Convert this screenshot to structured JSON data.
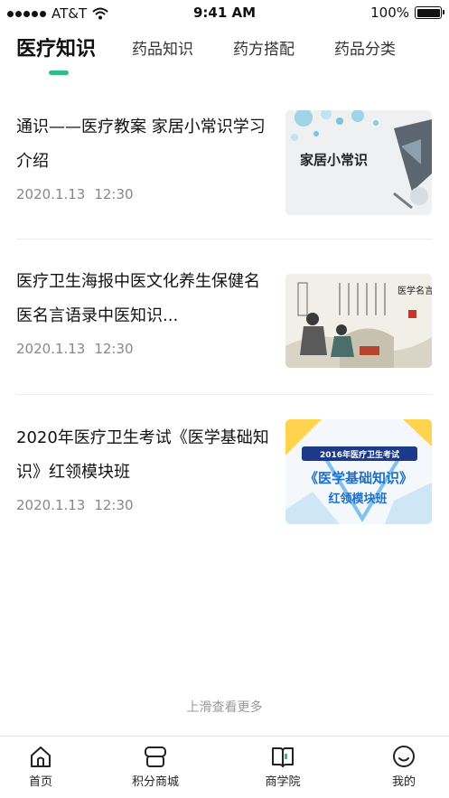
{
  "status_bar": {
    "carrier": "AT&T",
    "time": "9:41 AM",
    "battery": "100%"
  },
  "tabs": [
    {
      "label": "医疗知识",
      "active": true
    },
    {
      "label": "药品知识",
      "active": false
    },
    {
      "label": "药方搭配",
      "active": false
    },
    {
      "label": "药品分类",
      "active": false
    }
  ],
  "articles": [
    {
      "title": "通识——医疗教案 家居小常识学习介绍",
      "date": "2020.1.13",
      "time": "12:30",
      "thumb_text": "家居小常识"
    },
    {
      "title": "医疗卫生海报中医文化养生保健名医名言语录中医知识...",
      "date": "2020.1.13",
      "time": "12:30",
      "thumb_text": "医学名言"
    },
    {
      "title": "2020年医疗卫生考试《医学基础知识》红领模块班",
      "date": "2020.1.13",
      "time": "12:30",
      "thumb_line1": "2016年医疗卫生考试",
      "thumb_line2": "《医学基础知识》",
      "thumb_line3": "红领模块班"
    }
  ],
  "load_more": "上滑查看更多",
  "bottom_nav": [
    {
      "label": "首页",
      "icon": "home-icon"
    },
    {
      "label": "积分商城",
      "icon": "mall-icon"
    },
    {
      "label": "商学院",
      "icon": "book-icon"
    },
    {
      "label": "我的",
      "icon": "smile-icon"
    }
  ],
  "colors": {
    "accent": "#2dbf84",
    "text_primary": "#111111",
    "text_secondary": "#888888"
  }
}
